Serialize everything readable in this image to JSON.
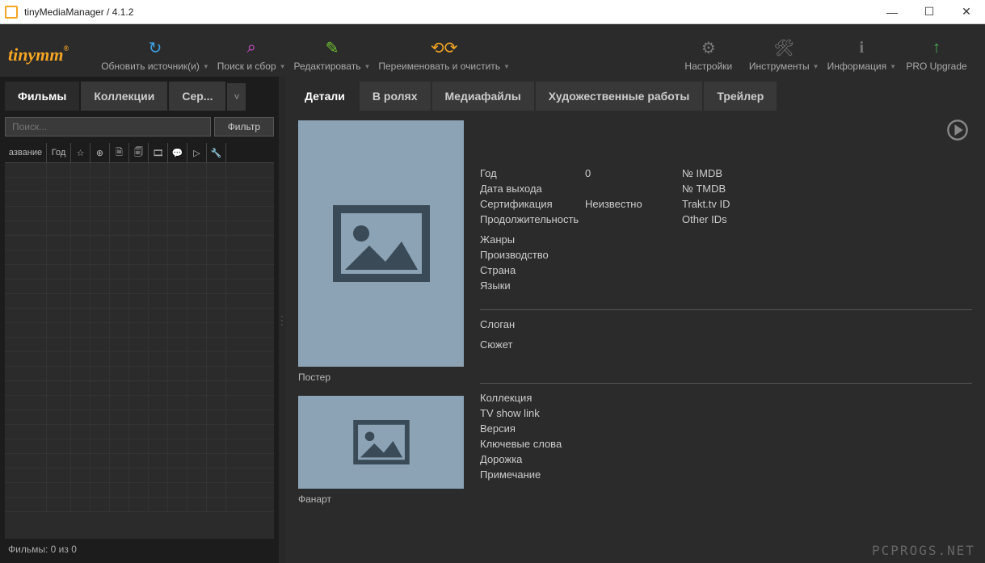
{
  "window": {
    "title": "tinyMediaManager / 4.1.2"
  },
  "logo": "tinymm",
  "toolbar": {
    "refresh": "Обновить источник(и)",
    "search": "Поиск и сбор",
    "edit": "Редактировать",
    "rename": "Переименовать и очистить",
    "settings": "Настройки",
    "tools": "Инструменты",
    "info": "Информация",
    "upgrade": "PRO Upgrade"
  },
  "leftTabs": {
    "movies": "Фильмы",
    "collections": "Коллекции",
    "series": "Сер..."
  },
  "search": {
    "placeholder": "Поиск...",
    "filter": "Фильтр"
  },
  "columns": {
    "name": "азвание",
    "year": "Год"
  },
  "status": {
    "label": "Фильмы:",
    "count": "0",
    "of": "из",
    "total": "0"
  },
  "detailTabs": {
    "details": "Детали",
    "cast": "В ролях",
    "media": "Медиафайлы",
    "art": "Художественные работы",
    "trailer": "Трейлер"
  },
  "mediaLabels": {
    "poster": "Постер",
    "fanart": "Фанарт"
  },
  "fields": {
    "year": "Год",
    "yearVal": "0",
    "release": "Дата выхода",
    "cert": "Сертификация",
    "certVal": "Неизвестно",
    "runtime": "Продолжительность",
    "genres": "Жанры",
    "studio": "Производство",
    "country": "Страна",
    "langs": "Языки",
    "imdb": "№ IMDB",
    "tmdb": "№ TMDB",
    "trakt": "Trakt.tv ID",
    "other": "Other IDs",
    "tagline": "Слоган",
    "plot": "Сюжет",
    "collection": "Коллекция",
    "tvlink": "TV show link",
    "version": "Версия",
    "keywords": "Ключевые слова",
    "track": "Дорожка",
    "note": "Примечание"
  },
  "watermark": "PCPROGS.NET"
}
